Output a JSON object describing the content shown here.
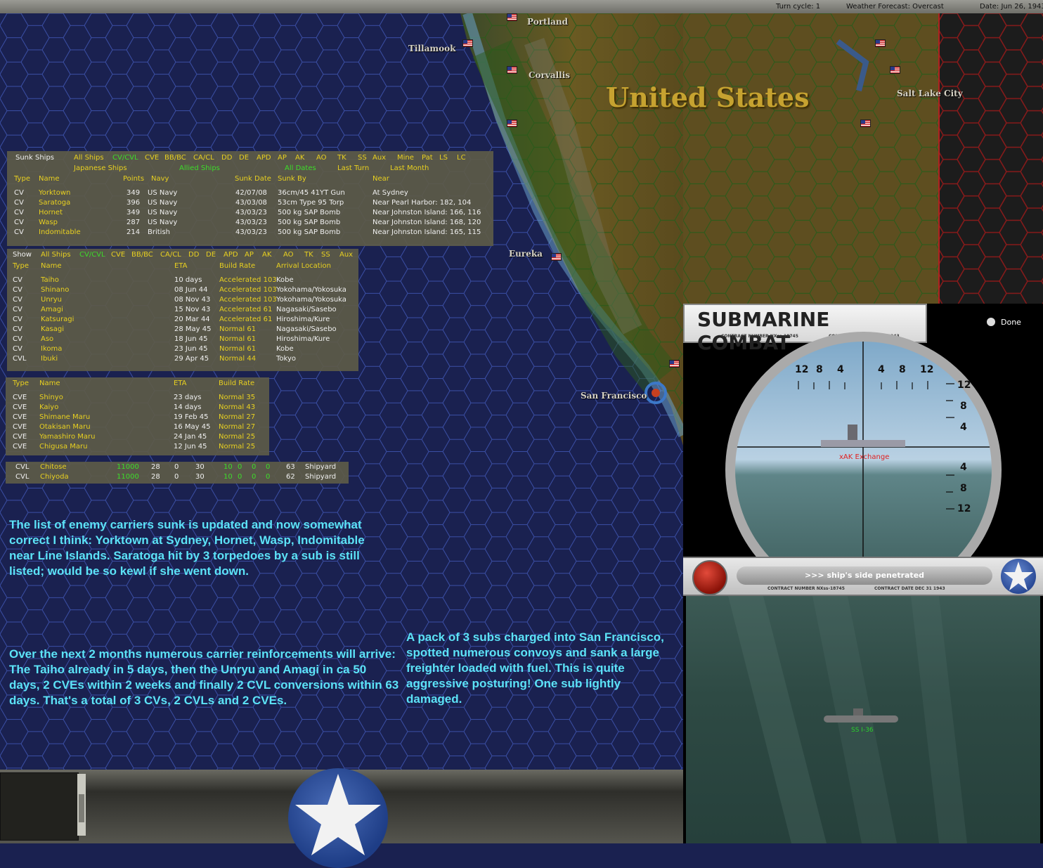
{
  "topbar": {
    "turn_cycle": "Turn cycle: 1",
    "weather": "Weather Forecast: Overcast",
    "date": "Date: Jun 26, 1943"
  },
  "map": {
    "country": "United States",
    "cities": {
      "portland": "Portland",
      "tillamook": "Tillamook",
      "corvallis": "Corvallis",
      "salt_lake_city": "Salt Lake City",
      "eureka": "Eureka",
      "san_francisco": "San Francisco"
    }
  },
  "sunk_panel": {
    "filters_row1": [
      "Sunk Ships",
      "All Ships",
      "CV/CVL",
      "CVE",
      "BB/BC",
      "CA/CL",
      "DD",
      "DE",
      "APD",
      "AP",
      "AK",
      "AO",
      "TK",
      "SS",
      "Aux",
      "Mine",
      "Pat",
      "LS",
      "LC"
    ],
    "filters_row2": [
      "Japanese Ships",
      "Allied Ships",
      "All Dates",
      "Last Turn",
      "Last Month"
    ],
    "headers": [
      "Type",
      "Name",
      "Points",
      "Navy",
      "Sunk Date",
      "Sunk By",
      "Near"
    ],
    "rows": [
      [
        "CV",
        "Yorktown",
        "349",
        "US Navy",
        "42/07/08",
        "36cm/45 41YT Gun",
        "At Sydney"
      ],
      [
        "CV",
        "Saratoga",
        "396",
        "US Navy",
        "43/03/08",
        "53cm Type 95 Torp",
        "Near Pearl Harbor: 182, 104"
      ],
      [
        "CV",
        "Hornet",
        "349",
        "US Navy",
        "43/03/23",
        "500 kg SAP Bomb",
        "Near Johnston Island: 166, 116"
      ],
      [
        "CV",
        "Wasp",
        "287",
        "US Navy",
        "43/03/23",
        "500 kg SAP Bomb",
        "Near Johnston Island: 168, 120"
      ],
      [
        "CV",
        "Indomitable",
        "214",
        "British",
        "43/03/23",
        "500 kg SAP Bomb",
        "Near Johnston Island: 165, 115"
      ]
    ]
  },
  "reinf_panel": {
    "filters": [
      "Show",
      "All Ships",
      "CV/CVL",
      "CVE",
      "BB/BC",
      "CA/CL",
      "DD",
      "DE",
      "APD",
      "AP",
      "AK",
      "AO",
      "TK",
      "SS",
      "Aux"
    ],
    "headers": [
      "Type",
      "Name",
      "ETA",
      "Build Rate",
      "Arrival Location"
    ],
    "rows": [
      [
        "CV",
        "Taiho",
        "10 days",
        "Accelerated 103",
        "Kobe"
      ],
      [
        "CV",
        "Shinano",
        "08 Jun 44",
        "Accelerated 103",
        "Yokohama/Yokosuka"
      ],
      [
        "CV",
        "Unryu",
        "08 Nov 43",
        "Accelerated 103",
        "Yokohama/Yokosuka"
      ],
      [
        "CV",
        "Amagi",
        "15 Nov 43",
        "Accelerated 61",
        "Nagasaki/Sasebo"
      ],
      [
        "CV",
        "Katsuragi",
        "20 Mar 44",
        "Accelerated 61",
        "Hiroshima/Kure"
      ],
      [
        "CV",
        "Kasagi",
        "28 May 45",
        "Normal 61",
        "Nagasaki/Sasebo"
      ],
      [
        "CV",
        "Aso",
        "18 Jun 45",
        "Normal 61",
        "Hiroshima/Kure"
      ],
      [
        "CV",
        "Ikoma",
        "23 Jun 45",
        "Normal 61",
        "Kobe"
      ],
      [
        "CVL",
        "Ibuki",
        "29 Apr 45",
        "Normal 44",
        "Tokyo"
      ]
    ]
  },
  "cve_panel": {
    "headers": [
      "Type",
      "Name",
      "ETA",
      "Build Rate"
    ],
    "rows": [
      [
        "CVE",
        "Shinyo",
        "23 days",
        "Normal 35"
      ],
      [
        "CVE",
        "Kaiyo",
        "14 days",
        "Normal 43"
      ],
      [
        "CVE",
        "Shimane Maru",
        "19 Feb 45",
        "Normal 27"
      ],
      [
        "CVE",
        "Otakisan Maru",
        "16 May 45",
        "Normal 27"
      ],
      [
        "CVE",
        "Yamashiro Maru",
        "24 Jan 45",
        "Normal 25"
      ],
      [
        "CVE",
        "Chigusa Maru",
        "12 Jun 45",
        "Normal 25"
      ]
    ]
  },
  "cvl_panel": {
    "rows": [
      [
        "CVL",
        "Chitose",
        "11000",
        "28",
        "0",
        "30",
        "10",
        "0",
        "0",
        "0",
        "63",
        "Shipyard"
      ],
      [
        "CVL",
        "Chiyoda",
        "11000",
        "28",
        "0",
        "30",
        "10",
        "0",
        "0",
        "0",
        "62",
        "Shipyard"
      ]
    ]
  },
  "notes": {
    "note1": "The list of enemy carriers sunk is updated and now somewhat correct I think: Yorktown at Sydney, Hornet, Wasp, Indomitable near Line Islands. Saratoga hit by 3 torpedoes by a sub is still listed; would be so kewl if she went down.",
    "note2": "Over the next 2 months numerous carrier reinforcements will arrive: The Taiho already in 5 days, then the Unryu and Amagi in ca 50 days, 2 CVEs within 2 weeks and finally 2 CVL conversions within 63 days. That's a total of 3 CVs, 2 CVLs and 2 CVEs.",
    "note3": "A pack of 3 subs charged into San Francisco, spotted numerous convoys and sank a large freighter loaded with fuel. This is quite aggressive posturing! One sub lightly damaged."
  },
  "submarine_combat": {
    "title": "SUBMARINE COMBAT",
    "contract_number": "CONTRACT NUMBER  NXss-18745",
    "contract_date": "CONTRACT DATE  DEC 31 1943",
    "done_label": "Done",
    "scale_top": [
      "12",
      "8",
      "4",
      "4",
      "8",
      "12"
    ],
    "scale_right": [
      "12",
      "8",
      "4",
      "4",
      "8",
      "12"
    ],
    "target_label": "xAK Exchange",
    "message": ">>> ship's side penetrated",
    "sub_label": "SS I-36"
  },
  "colors": {
    "ocean": "#1a2150",
    "panel": "#5c5a48",
    "note_text": "#5ce3f7",
    "yellow_text": "#e8d020",
    "green_text": "#3ddc2a"
  }
}
